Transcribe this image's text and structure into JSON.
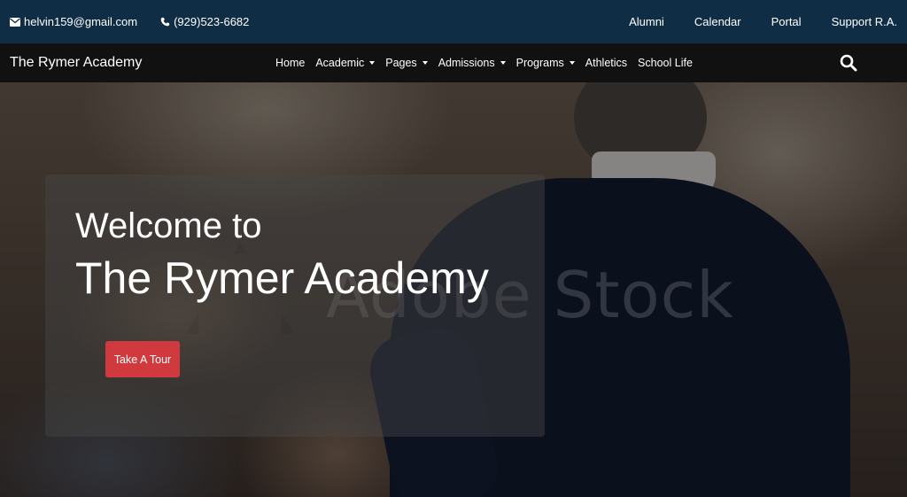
{
  "topbar": {
    "email": "helvin159@gmail.com",
    "phone": "(929)523-6682",
    "links": [
      "Alumni",
      "Calendar",
      "Portal",
      "Support R.A."
    ]
  },
  "navbar": {
    "brand": "The Rymer Academy",
    "menu": [
      {
        "label": "Home",
        "dropdown": false
      },
      {
        "label": "Academic",
        "dropdown": true
      },
      {
        "label": "Pages",
        "dropdown": true
      },
      {
        "label": "Admissions",
        "dropdown": true
      },
      {
        "label": "Programs",
        "dropdown": true
      },
      {
        "label": "Athletics",
        "dropdown": false
      },
      {
        "label": "School Life",
        "dropdown": false
      }
    ],
    "search_icon": "search-icon"
  },
  "hero": {
    "welcome": "Welcome to",
    "title": "The Rymer Academy",
    "button": "Take A Tour",
    "watermark": "Adobe Stock"
  },
  "colors": {
    "topbar_bg": "#0f2d45",
    "navbar_bg": "#121010",
    "button_bg": "#d0393e"
  }
}
